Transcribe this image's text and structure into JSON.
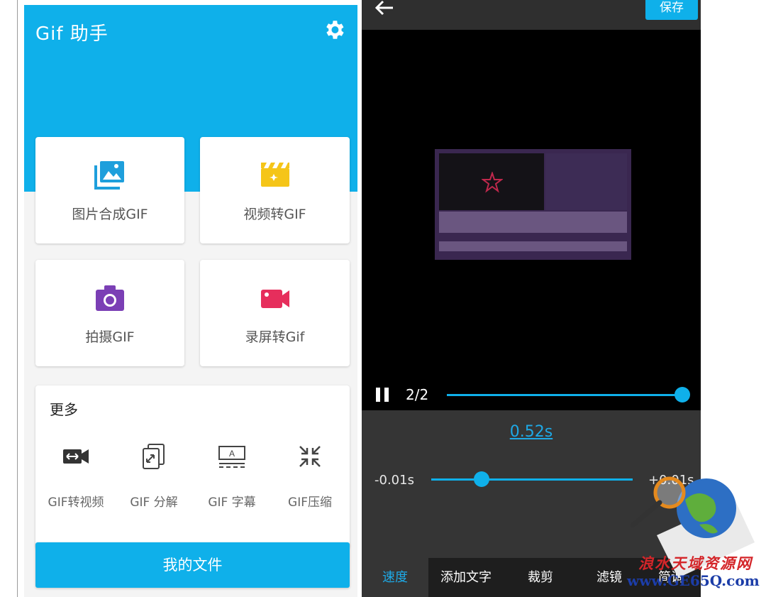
{
  "left_app": {
    "title": "Gif 助手",
    "settings_icon": "gear-icon",
    "cards": [
      {
        "label": "图片合成GIF",
        "icon": "image-stack-icon",
        "color": "#1e9fdc"
      },
      {
        "label": "视频转GIF",
        "icon": "clapperboard-icon",
        "color": "#f5c518"
      },
      {
        "label": "拍摄GIF",
        "icon": "camera-icon",
        "color": "#7b3fb5"
      },
      {
        "label": "录屏转Gif",
        "icon": "video-camera-icon",
        "color": "#e62e5c"
      }
    ],
    "more": {
      "title": "更多",
      "tools": [
        {
          "label": "GIF转视频",
          "icon": "gif-to-video-icon"
        },
        {
          "label": "GIF 分解",
          "icon": "split-icon"
        },
        {
          "label": "GIF 字幕",
          "icon": "subtitle-icon"
        },
        {
          "label": "GIF压缩",
          "icon": "compress-icon"
        }
      ]
    },
    "my_files_label": "我的文件",
    "accent_color": "#0fb0ea"
  },
  "editor": {
    "back_icon": "arrow-left-icon",
    "save_label": "保存",
    "frame_indicator": "2/2",
    "speed_value": "0.52s",
    "speed_min_label": "-0.01s",
    "speed_max_label": "+0.01s",
    "tabs": [
      {
        "label": "速度",
        "active": true
      },
      {
        "label": "添加文字",
        "active": false
      },
      {
        "label": "裁剪",
        "active": false
      },
      {
        "label": "滤镜",
        "active": false
      },
      {
        "label": "简调",
        "active": false
      }
    ]
  },
  "watermark": {
    "text_cn": "浪水天域资源网",
    "text_url": "www.GE65Q.com"
  }
}
